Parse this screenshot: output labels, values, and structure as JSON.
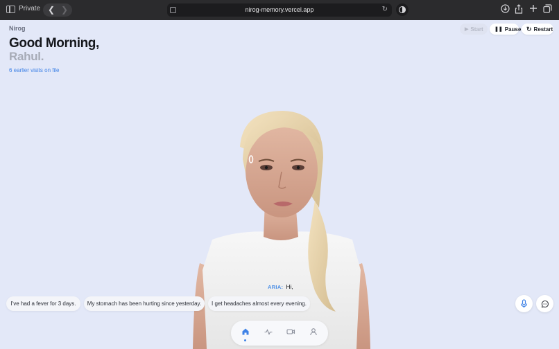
{
  "browser": {
    "private_label": "Private",
    "url": "nirog-memory.vercel.app"
  },
  "app": {
    "brand": "Nirog",
    "greeting_line1": "Good Morning,",
    "greeting_line2": "Rahul.",
    "visits_link": "6 earlier visits on file"
  },
  "controls": {
    "start_label": "Start",
    "pause_label": "Pause",
    "restart_label": "Restart"
  },
  "caption": {
    "speaker": "ARIA:",
    "text": "Hi,"
  },
  "suggestions": [
    "I've had a fever for 3 days.",
    "My stomach has been hurting since yesterday.",
    "I get headaches almost every evening."
  ],
  "tabs": [
    {
      "icon": "home-icon",
      "active": true
    },
    {
      "icon": "activity-icon",
      "active": false
    },
    {
      "icon": "video-icon",
      "active": false
    },
    {
      "icon": "profile-icon",
      "active": false
    }
  ],
  "colors": {
    "background": "#e3e8f8",
    "accent": "#3f82e6",
    "chrome": "#2b2b2d"
  }
}
